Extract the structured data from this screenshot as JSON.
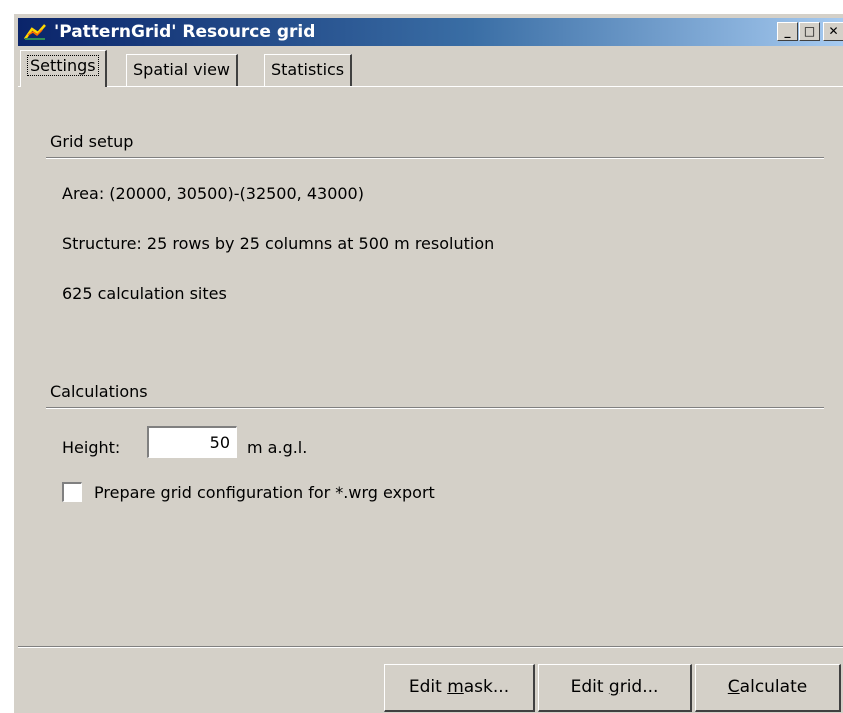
{
  "window": {
    "title": "'PatternGrid' Resource grid",
    "controls": {
      "minimize": "_",
      "maximize": "□",
      "close": "✕"
    }
  },
  "tabs": [
    {
      "label": "Settings",
      "active": true
    },
    {
      "label": "Spatial view",
      "active": false
    },
    {
      "label": "Statistics",
      "active": false
    }
  ],
  "grid_setup": {
    "heading": "Grid setup",
    "area": "Area: (20000, 30500)-(32500, 43000)",
    "structure": "Structure: 25 rows by 25 columns at 500 m resolution",
    "sites": "625 calculation sites"
  },
  "calculations": {
    "heading": "Calculations",
    "height_label": "Height:",
    "height_value": "50",
    "height_unit": "m a.g.l.",
    "wrg_checkbox_label": "Prepare grid configuration for *.wrg export",
    "wrg_checked": false
  },
  "buttons": {
    "edit_mask": {
      "before": "Edit ",
      "accel": "m",
      "after": "ask..."
    },
    "edit_grid": {
      "before": "Edit ",
      "accel": "g",
      "after": "rid..."
    },
    "calculate": {
      "before": "",
      "accel": "C",
      "after": "alculate"
    }
  },
  "colors": {
    "face": "#d4d0c8",
    "title_start": "#0a246a",
    "title_end": "#a6caf0"
  }
}
